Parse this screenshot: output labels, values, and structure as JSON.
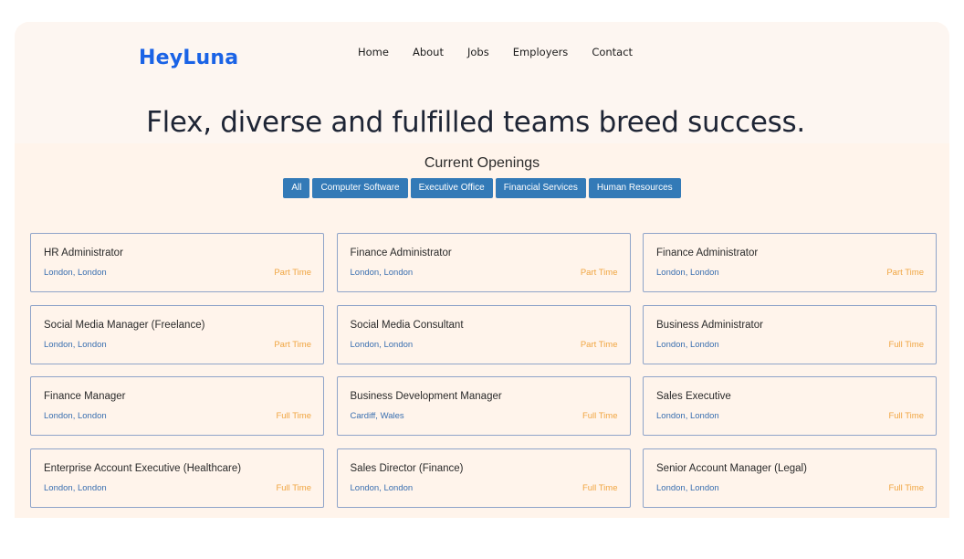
{
  "header": {
    "logo": "HeyLuna",
    "nav": [
      "Home",
      "About",
      "Jobs",
      "Employers",
      "Contact"
    ],
    "headline": "Flex, diverse and fulfilled teams breed success."
  },
  "openings": {
    "title": "Current Openings",
    "filters": [
      "All",
      "Computer Software",
      "Executive Office",
      "Financial Services",
      "Human Resources"
    ],
    "jobs": [
      {
        "title": "HR Administrator",
        "location": "London, London",
        "type": "Part Time"
      },
      {
        "title": "Finance Administrator",
        "location": "London, London",
        "type": "Part Time"
      },
      {
        "title": "Finance Administrator",
        "location": "London, London",
        "type": "Part Time"
      },
      {
        "title": "Social Media Manager (Freelance)",
        "location": "London, London",
        "type": "Part Time"
      },
      {
        "title": "Social Media Consultant",
        "location": "London, London",
        "type": "Part Time"
      },
      {
        "title": "Business Administrator",
        "location": "London, London",
        "type": "Full Time"
      },
      {
        "title": "Finance Manager",
        "location": "London, London",
        "type": "Full Time"
      },
      {
        "title": "Business Development Manager",
        "location": "Cardiff, Wales",
        "type": "Full Time"
      },
      {
        "title": "Sales Executive",
        "location": "London, London",
        "type": "Full Time"
      },
      {
        "title": "Enterprise Account Executive (Healthcare)",
        "location": "London, London",
        "type": "Full Time"
      },
      {
        "title": "Sales Director (Finance)",
        "location": "London, London",
        "type": "Full Time"
      },
      {
        "title": "Senior Account Manager (Legal)",
        "location": "London, London",
        "type": "Full Time"
      }
    ]
  },
  "colors": {
    "logo": "#1a63e6",
    "filter_button": "#337ab7",
    "location_text": "#3a6fb0",
    "job_type_text": "#f0a541",
    "card_border": "#8fa4c9",
    "page_background": "#fff4eb"
  }
}
